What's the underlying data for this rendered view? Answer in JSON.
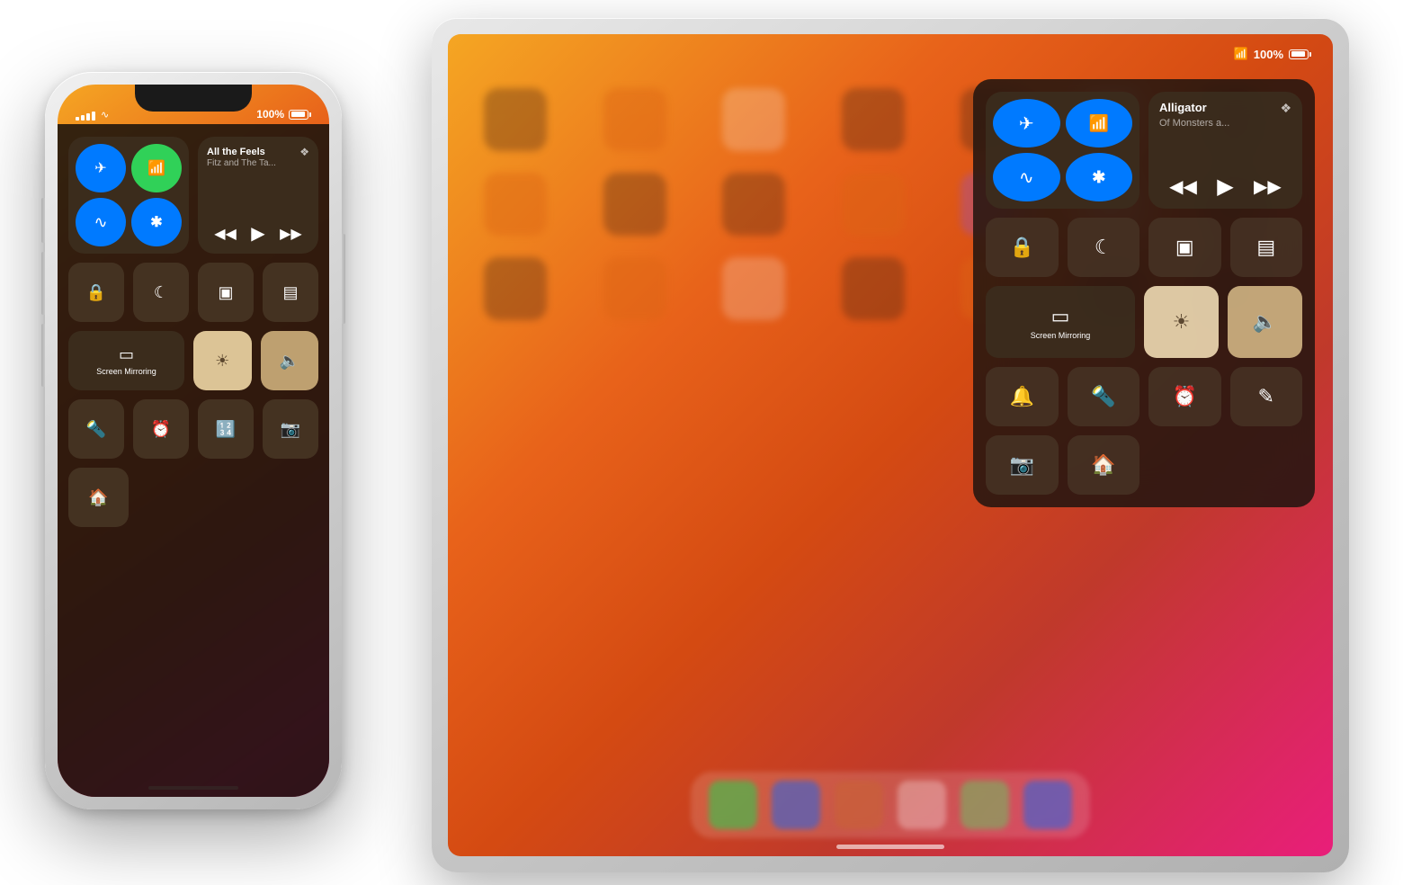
{
  "scene": {
    "bg_color": "#ffffff"
  },
  "ipad": {
    "status": {
      "battery": "100%",
      "wifi_icon": "wifi"
    },
    "control_center": {
      "connectivity": {
        "airplane_active": true,
        "cellular_active": true,
        "wifi_active": true,
        "bluetooth_active": true
      },
      "music": {
        "title": "Alligator",
        "artist": "Of Monsters a...",
        "airplay_icon": "airplay"
      },
      "buttons": {
        "rotation_lock": "rotation-lock",
        "do_not_disturb": "do-not-disturb",
        "btn3": "dark",
        "btn4": "dark",
        "screen_mirror": "Screen Mirroring",
        "brightness": "brightness",
        "volume": "volume",
        "bell": "bell",
        "flashlight": "flashlight",
        "timer": "timer",
        "notes": "notes",
        "camera": "camera",
        "home": "home"
      }
    }
  },
  "iphone": {
    "status": {
      "battery": "100%",
      "wifi_icon": "wifi"
    },
    "control_center": {
      "music": {
        "title": "All the Feels",
        "artist": "Fitz and The Ta...",
        "airplay_icon": "airplay"
      },
      "connectivity": {
        "airplane_active": true,
        "cellular_active": true,
        "wifi_active": true,
        "bluetooth_active": true
      }
    }
  }
}
